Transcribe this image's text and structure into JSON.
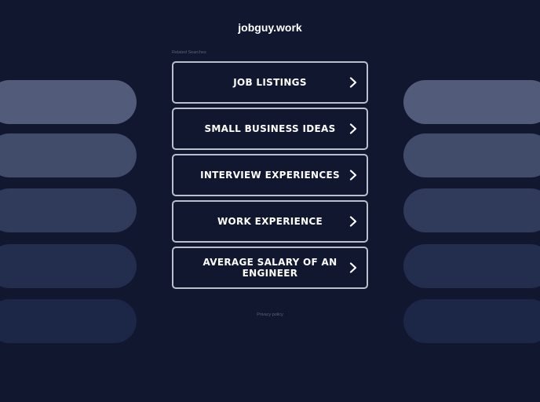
{
  "site": {
    "title": "jobguy.work"
  },
  "related": {
    "label": "Related Searches",
    "links": [
      {
        "label": "JOB LISTINGS"
      },
      {
        "label": "SMALL BUSINESS IDEAS"
      },
      {
        "label": "INTERVIEW EXPERIENCES"
      },
      {
        "label": "WORK EXPERIENCE"
      },
      {
        "label": "AVERAGE SALARY OF AN ENGINEER"
      }
    ]
  },
  "footer": {
    "privacy_label": "Privacy policy"
  },
  "colors": {
    "background": "#11172f",
    "box_border": "#b9bfcc",
    "pill_1": "#525c7a",
    "pill_2": "#414b6a",
    "pill_3": "#303a5a",
    "pill_4": "#232d4e",
    "pill_5": "#1c2647"
  },
  "icons": {
    "link_arrow": "chevron-right-icon"
  }
}
